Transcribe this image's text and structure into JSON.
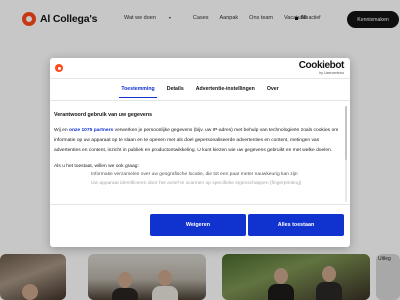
{
  "header": {
    "logo_text": "Al Collega's",
    "nav": [
      {
        "label": "Wat we doen",
        "dropdown": true
      },
      {
        "label": "Cases",
        "dropdown": false
      },
      {
        "label": "Aanpak",
        "dropdown": false
      },
      {
        "label": "Ons team",
        "dropdown": false
      },
      {
        "label": "Vacatures",
        "dropdown": false
      }
    ],
    "active_count": "50",
    "active_label": "actief",
    "cta_label": "Kennismaken"
  },
  "background": {
    "uitleg_label": "Uitleg"
  },
  "dialog": {
    "brand_name": "Cookiebot",
    "brand_by": "by Usercentrics",
    "tabs": [
      {
        "label": "Toestemming",
        "active": true
      },
      {
        "label": "Details",
        "active": false
      },
      {
        "label": "Advertentie-instellingen",
        "active": false
      },
      {
        "label": "Over",
        "active": false
      }
    ],
    "content": {
      "title": "Verantwoord gebruik van uw gegevens",
      "para_start": "Wij en ",
      "partners_link": "onze 1075 partners",
      "para_rest": " verwerken je persoonlijke gegevens (bijv. uw IP-adres) met behulp van technologieën zoals cookies om informatie op uw apparaat op te slaan en te openen met als doel gepersonaliseerde advertenties en content, metingen van advertenties en content, inzicht in publiek en productontwikkeling. U kunt kiezen wie uw gegevens gebruikt en met welke doelen.",
      "ask": "Als u het toestaat, willen we ook graag:",
      "list": [
        "Informatie verzamelen over uw geografische locatie, die tot een paar meter nauwkeurig kan zijn",
        "Uw apparaat identificeren door het actief te scannen op specifieke eigenschappen (fingerprinting)"
      ]
    },
    "buttons": {
      "deny": "Weigeren",
      "allow_all": "Alles toestaan"
    }
  },
  "colors": {
    "accent": "#1032cf",
    "brand": "#ff4a1c",
    "dark": "#141414"
  }
}
